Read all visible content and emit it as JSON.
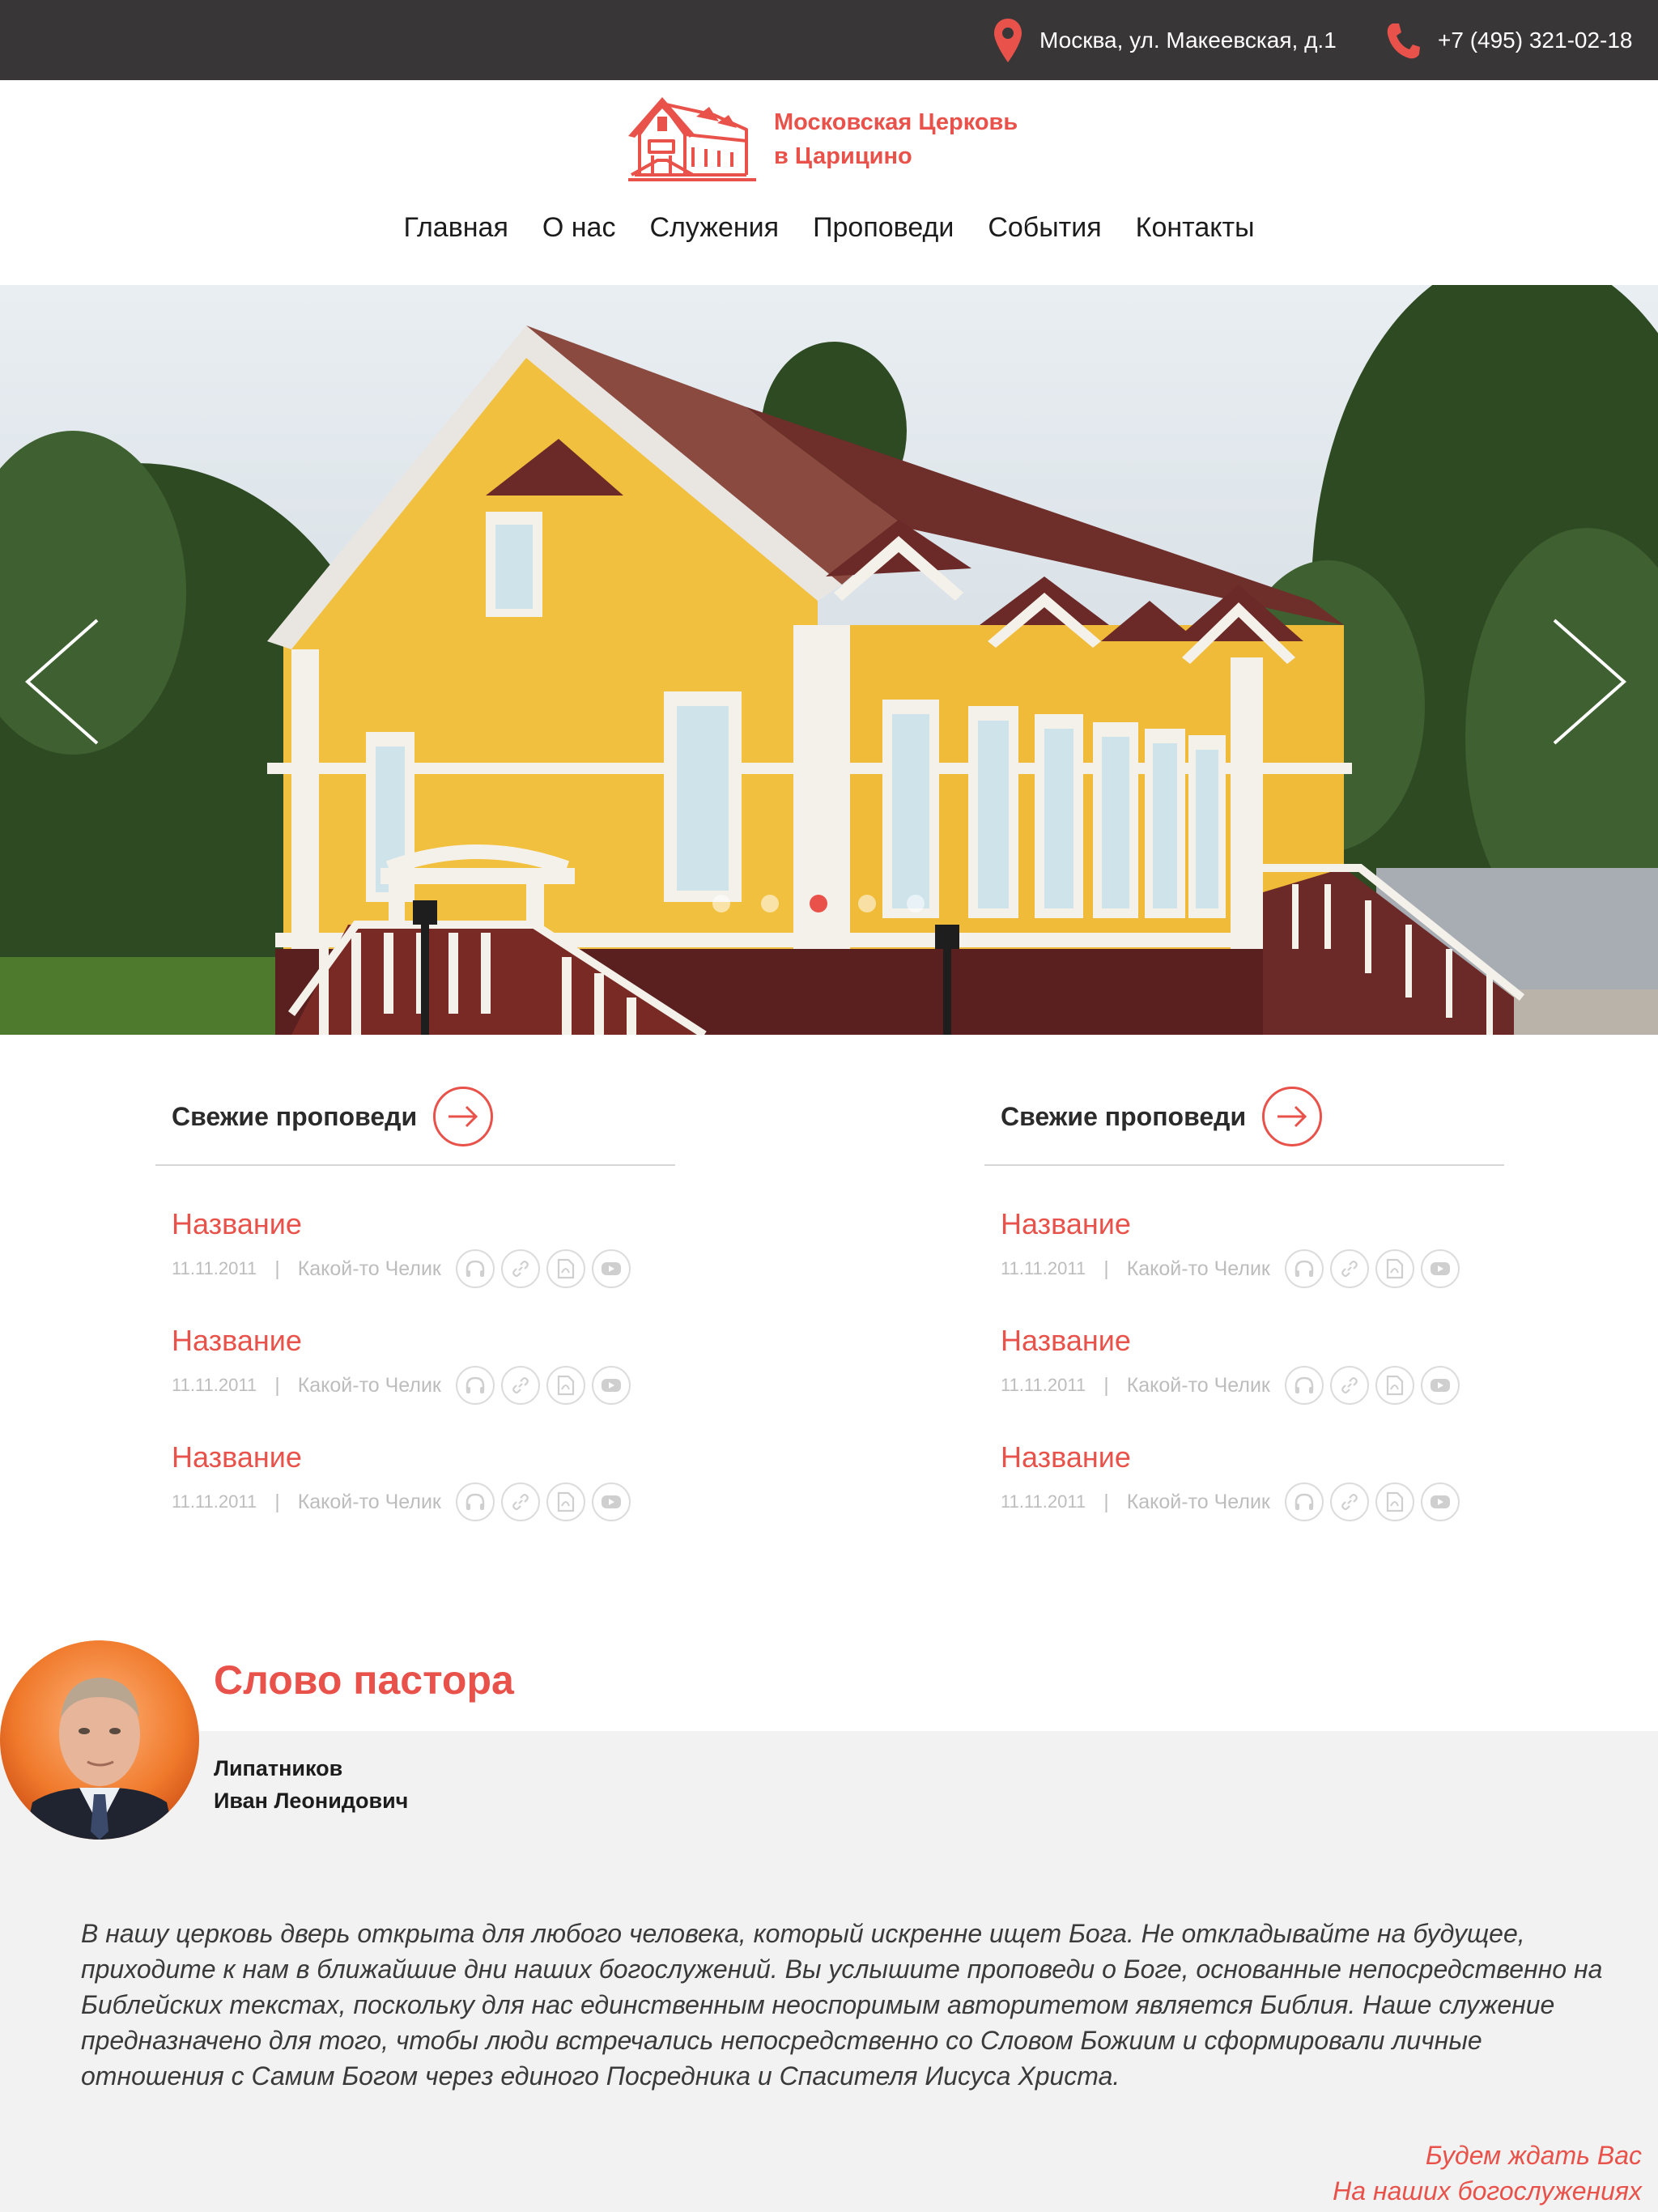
{
  "topbar": {
    "address": "Москва, ул. Макеевская, д.1",
    "phone": "+7 (495) 321-02-18",
    "address_icon": "map-pin-icon",
    "phone_icon": "phone-icon"
  },
  "logo": {
    "line1": "Московская Церковь",
    "line2": "в Царицино"
  },
  "nav": [
    "Главная",
    "О нас",
    "Служения",
    "Проповеди",
    "События",
    "Контакты"
  ],
  "slider": {
    "slides": 5,
    "active_slide": 3
  },
  "sermon_columns": [
    {
      "heading": "Свежие проповеди",
      "items": [
        {
          "title": "Название",
          "date": "11.11.2011",
          "author": "Какой-то Челик"
        },
        {
          "title": "Название",
          "date": "11.11.2011",
          "author": "Какой-то Челик"
        },
        {
          "title": "Название",
          "date": "11.11.2011",
          "author": "Какой-то Челик"
        }
      ]
    },
    {
      "heading": "Свежие проповеди",
      "items": [
        {
          "title": "Название",
          "date": "11.11.2011",
          "author": "Какой-то Челик"
        },
        {
          "title": "Название",
          "date": "11.11.2011",
          "author": "Какой-то Челик"
        },
        {
          "title": "Название",
          "date": "11.11.2011",
          "author": "Какой-то Челик"
        }
      ]
    }
  ],
  "sermon_meta_separator": "|",
  "pastor": {
    "heading": "Слово пастора",
    "surname": "Липатников",
    "first_names": "Иван Леонидович",
    "quote": "В нашу церковь дверь открыта для любого человека, который искренне ищет Бога. Не откладывайте на будущее, приходите к нам в ближайшие дни наших богослужений. Вы услышите проповеди о Боге, основанные непосредственно на Библейских текстах, поскольку для нас единственным неоспоримым авторитетом является Библия. Наше служение предназначено для того, чтобы люди встречались непосредственно со Словом Божиим и сформировали личные отношения с Самим Богом через единого Посредника и Спасителя Иисуса Христа.",
    "sign_line1": "Будем ждать Вас",
    "sign_line2": "На наших богослужениях"
  },
  "colors": {
    "accent": "#e8524a",
    "topbar": "#383637",
    "muted": "#bdbdbd",
    "panel": "#f2f2f2"
  }
}
